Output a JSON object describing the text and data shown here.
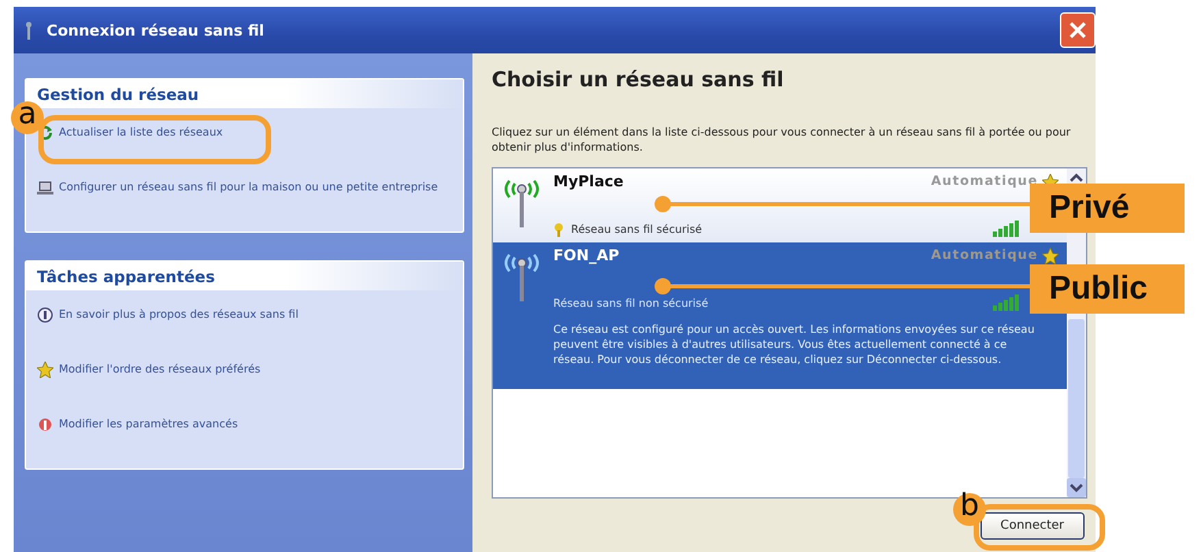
{
  "window": {
    "title": "Connexion réseau sans fil"
  },
  "left_pane": {
    "sections": [
      {
        "title": "Gestion du réseau",
        "items": [
          {
            "label": "Actualiser la liste des réseaux"
          },
          {
            "label": "Configurer un réseau sans fil pour la maison ou une petite entreprise"
          }
        ]
      },
      {
        "title": "Tâches apparentées",
        "items": [
          {
            "label": "En savoir plus à propos des réseaux sans fil"
          },
          {
            "label": "Modifier l'ordre des réseaux préférés"
          },
          {
            "label": "Modifier les paramètres avancés"
          }
        ]
      }
    ]
  },
  "main": {
    "heading": "Choisir un réseau sans fil",
    "description": "Cliquez sur un élément dans la liste ci-dessous pour vous connecter à un réseau sans fil à portée ou pour obtenir plus d'informations.",
    "networks": [
      {
        "name": "MyPlace",
        "mode": "Automatique",
        "status": "Réseau sans fil sécurisé",
        "secured": true,
        "selected": false
      },
      {
        "name": "FON_AP",
        "mode": "Automatique",
        "status": "Réseau sans fil non sécurisé",
        "secured": false,
        "selected": true,
        "detail": "Ce réseau est configuré pour un accès ouvert. Les informations envoyées sur ce réseau peuvent être visibles à d'autres utilisateurs. Vous êtes actuellement connecté à ce réseau. Pour vous déconnecter de ce réseau, cliquez sur Déconnecter ci-dessous."
      }
    ],
    "buttons": [
      {
        "label": "Connecter"
      }
    ]
  },
  "annotations": {
    "markers": [
      {
        "label": "a"
      },
      {
        "label": "b"
      }
    ],
    "callouts": [
      {
        "label": "Privé"
      },
      {
        "label": "Public"
      }
    ]
  }
}
